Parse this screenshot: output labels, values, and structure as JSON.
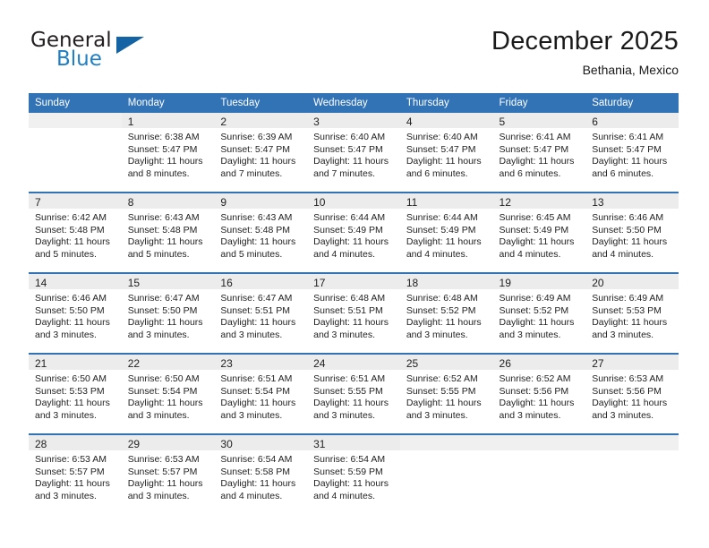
{
  "brand": {
    "name_top": "General",
    "name_bottom": "Blue",
    "accent_color": "#1464a5",
    "text_color": "#231f20"
  },
  "header": {
    "title": "December 2025",
    "subtitle": "Bethania, Mexico"
  },
  "theme": {
    "header_bg": "#3273b5",
    "header_text": "#ffffff",
    "daynum_bg": "#ececec",
    "cell_bg": "#ffffff",
    "row_separator": "#3273b5"
  },
  "calendar": {
    "weekday_headers": [
      "Sunday",
      "Monday",
      "Tuesday",
      "Wednesday",
      "Thursday",
      "Friday",
      "Saturday"
    ],
    "weeks": [
      [
        {
          "day": "",
          "lines": []
        },
        {
          "day": "1",
          "lines": [
            "Sunrise: 6:38 AM",
            "Sunset: 5:47 PM",
            "Daylight: 11 hours",
            "and 8 minutes."
          ]
        },
        {
          "day": "2",
          "lines": [
            "Sunrise: 6:39 AM",
            "Sunset: 5:47 PM",
            "Daylight: 11 hours",
            "and 7 minutes."
          ]
        },
        {
          "day": "3",
          "lines": [
            "Sunrise: 6:40 AM",
            "Sunset: 5:47 PM",
            "Daylight: 11 hours",
            "and 7 minutes."
          ]
        },
        {
          "day": "4",
          "lines": [
            "Sunrise: 6:40 AM",
            "Sunset: 5:47 PM",
            "Daylight: 11 hours",
            "and 6 minutes."
          ]
        },
        {
          "day": "5",
          "lines": [
            "Sunrise: 6:41 AM",
            "Sunset: 5:47 PM",
            "Daylight: 11 hours",
            "and 6 minutes."
          ]
        },
        {
          "day": "6",
          "lines": [
            "Sunrise: 6:41 AM",
            "Sunset: 5:47 PM",
            "Daylight: 11 hours",
            "and 6 minutes."
          ]
        }
      ],
      [
        {
          "day": "7",
          "lines": [
            "Sunrise: 6:42 AM",
            "Sunset: 5:48 PM",
            "Daylight: 11 hours",
            "and 5 minutes."
          ]
        },
        {
          "day": "8",
          "lines": [
            "Sunrise: 6:43 AM",
            "Sunset: 5:48 PM",
            "Daylight: 11 hours",
            "and 5 minutes."
          ]
        },
        {
          "day": "9",
          "lines": [
            "Sunrise: 6:43 AM",
            "Sunset: 5:48 PM",
            "Daylight: 11 hours",
            "and 5 minutes."
          ]
        },
        {
          "day": "10",
          "lines": [
            "Sunrise: 6:44 AM",
            "Sunset: 5:49 PM",
            "Daylight: 11 hours",
            "and 4 minutes."
          ]
        },
        {
          "day": "11",
          "lines": [
            "Sunrise: 6:44 AM",
            "Sunset: 5:49 PM",
            "Daylight: 11 hours",
            "and 4 minutes."
          ]
        },
        {
          "day": "12",
          "lines": [
            "Sunrise: 6:45 AM",
            "Sunset: 5:49 PM",
            "Daylight: 11 hours",
            "and 4 minutes."
          ]
        },
        {
          "day": "13",
          "lines": [
            "Sunrise: 6:46 AM",
            "Sunset: 5:50 PM",
            "Daylight: 11 hours",
            "and 4 minutes."
          ]
        }
      ],
      [
        {
          "day": "14",
          "lines": [
            "Sunrise: 6:46 AM",
            "Sunset: 5:50 PM",
            "Daylight: 11 hours",
            "and 3 minutes."
          ]
        },
        {
          "day": "15",
          "lines": [
            "Sunrise: 6:47 AM",
            "Sunset: 5:50 PM",
            "Daylight: 11 hours",
            "and 3 minutes."
          ]
        },
        {
          "day": "16",
          "lines": [
            "Sunrise: 6:47 AM",
            "Sunset: 5:51 PM",
            "Daylight: 11 hours",
            "and 3 minutes."
          ]
        },
        {
          "day": "17",
          "lines": [
            "Sunrise: 6:48 AM",
            "Sunset: 5:51 PM",
            "Daylight: 11 hours",
            "and 3 minutes."
          ]
        },
        {
          "day": "18",
          "lines": [
            "Sunrise: 6:48 AM",
            "Sunset: 5:52 PM",
            "Daylight: 11 hours",
            "and 3 minutes."
          ]
        },
        {
          "day": "19",
          "lines": [
            "Sunrise: 6:49 AM",
            "Sunset: 5:52 PM",
            "Daylight: 11 hours",
            "and 3 minutes."
          ]
        },
        {
          "day": "20",
          "lines": [
            "Sunrise: 6:49 AM",
            "Sunset: 5:53 PM",
            "Daylight: 11 hours",
            "and 3 minutes."
          ]
        }
      ],
      [
        {
          "day": "21",
          "lines": [
            "Sunrise: 6:50 AM",
            "Sunset: 5:53 PM",
            "Daylight: 11 hours",
            "and 3 minutes."
          ]
        },
        {
          "day": "22",
          "lines": [
            "Sunrise: 6:50 AM",
            "Sunset: 5:54 PM",
            "Daylight: 11 hours",
            "and 3 minutes."
          ]
        },
        {
          "day": "23",
          "lines": [
            "Sunrise: 6:51 AM",
            "Sunset: 5:54 PM",
            "Daylight: 11 hours",
            "and 3 minutes."
          ]
        },
        {
          "day": "24",
          "lines": [
            "Sunrise: 6:51 AM",
            "Sunset: 5:55 PM",
            "Daylight: 11 hours",
            "and 3 minutes."
          ]
        },
        {
          "day": "25",
          "lines": [
            "Sunrise: 6:52 AM",
            "Sunset: 5:55 PM",
            "Daylight: 11 hours",
            "and 3 minutes."
          ]
        },
        {
          "day": "26",
          "lines": [
            "Sunrise: 6:52 AM",
            "Sunset: 5:56 PM",
            "Daylight: 11 hours",
            "and 3 minutes."
          ]
        },
        {
          "day": "27",
          "lines": [
            "Sunrise: 6:53 AM",
            "Sunset: 5:56 PM",
            "Daylight: 11 hours",
            "and 3 minutes."
          ]
        }
      ],
      [
        {
          "day": "28",
          "lines": [
            "Sunrise: 6:53 AM",
            "Sunset: 5:57 PM",
            "Daylight: 11 hours",
            "and 3 minutes."
          ]
        },
        {
          "day": "29",
          "lines": [
            "Sunrise: 6:53 AM",
            "Sunset: 5:57 PM",
            "Daylight: 11 hours",
            "and 3 minutes."
          ]
        },
        {
          "day": "30",
          "lines": [
            "Sunrise: 6:54 AM",
            "Sunset: 5:58 PM",
            "Daylight: 11 hours",
            "and 4 minutes."
          ]
        },
        {
          "day": "31",
          "lines": [
            "Sunrise: 6:54 AM",
            "Sunset: 5:59 PM",
            "Daylight: 11 hours",
            "and 4 minutes."
          ]
        },
        {
          "day": "",
          "lines": []
        },
        {
          "day": "",
          "lines": []
        },
        {
          "day": "",
          "lines": []
        }
      ]
    ]
  }
}
